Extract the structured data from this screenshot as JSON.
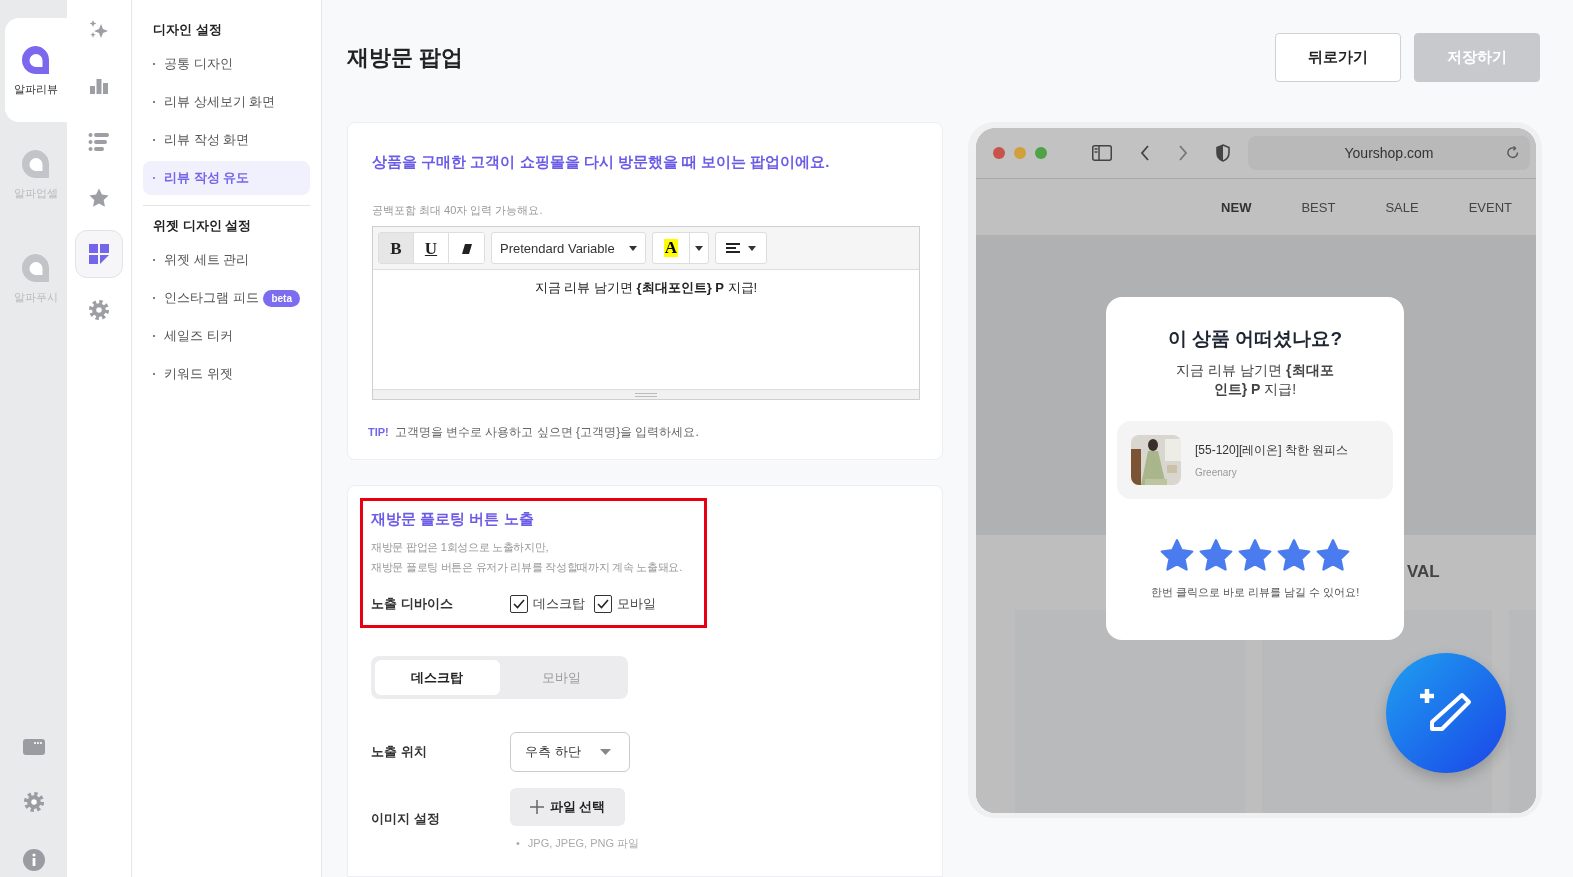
{
  "app_rail": {
    "items": [
      {
        "label": "알파리뷰",
        "selected": true
      },
      {
        "label": "알파업셀",
        "selected": false
      },
      {
        "label": "알파푸시",
        "selected": false
      }
    ],
    "footer_icons": [
      {
        "kind": "chat"
      },
      {
        "kind": "gear"
      },
      {
        "kind": "info"
      }
    ]
  },
  "icon_rail": {
    "items": [
      {
        "kind": "sparkle",
        "selected": false
      },
      {
        "kind": "chart",
        "selected": false
      },
      {
        "kind": "list",
        "selected": false
      },
      {
        "kind": "star",
        "selected": false
      },
      {
        "kind": "grid",
        "selected": true
      },
      {
        "kind": "gear",
        "selected": false
      }
    ]
  },
  "submenu": {
    "sections": [
      {
        "title": "디자인 설정",
        "items": [
          {
            "label": "공통 디자인",
            "selected": false
          },
          {
            "label": "리뷰 상세보기 화면",
            "selected": false
          },
          {
            "label": "리뷰 작성 화면",
            "selected": false
          },
          {
            "label": "리뷰 작성 유도",
            "selected": true
          }
        ]
      },
      {
        "title": "위젯 디자인 설정",
        "items": [
          {
            "label": "위젯 세트 관리",
            "selected": false
          },
          {
            "label": "인스타그램 피드",
            "badge": "beta",
            "selected": false
          },
          {
            "label": "세일즈 티커",
            "selected": false
          },
          {
            "label": "키워드 위젯",
            "selected": false
          }
        ]
      }
    ]
  },
  "header": {
    "title": "재방문 팝업",
    "buttons": [
      {
        "label": "뒤로가기",
        "disabled": false
      },
      {
        "label": "저장하기",
        "disabled": true
      }
    ]
  },
  "message_card": {
    "heading": "상품을 구매한 고객이 쇼핑몰을 다시 방문했을 때 보이는 팝업이에요.",
    "hint": "공백포함 최대 40자 입력 가능해요.",
    "editor": {
      "format_buttons": [
        {
          "kind": "bold",
          "label": "B",
          "active": true
        },
        {
          "kind": "underline",
          "label": "U",
          "active": false
        },
        {
          "kind": "eraser",
          "active": false
        }
      ],
      "font": "Pretendard Variable",
      "color_label": "A",
      "content": "지금 리뷰 남기면 **{최대포인트} P** 지급!"
    },
    "tip_label": "TIP!",
    "tip": "고객명을 변수로 사용하고 싶으면 {고객명}을 입력하세요."
  },
  "floating_card": {
    "highlighted": true,
    "title": "재방문 플로팅 버튼 노출",
    "description": [
      "재방문 팝업은 1회성으로 노출하지만,",
      "재방문 플로팅 버튼은 유저가 리뷰를 작성할때까지 계속 노출돼요."
    ],
    "device_label": "노출 디바이스",
    "devices": [
      {
        "label": "데스크탑",
        "checked": true
      },
      {
        "label": "모바일",
        "checked": true
      }
    ],
    "view_tabs": [
      {
        "label": "데스크탑",
        "selected": true
      },
      {
        "label": "모바일",
        "selected": false
      }
    ],
    "position": {
      "label": "노출 위치",
      "value": "우측 하단"
    },
    "image": {
      "label": "이미지 설정",
      "button": "파일 선택",
      "note_marker": "•",
      "notes": [
        "JPG, JPEG, PNG 파일"
      ]
    }
  },
  "preview": {
    "url": "Yourshop.com",
    "nav": [
      {
        "label": "NEW",
        "selected": true
      },
      {
        "label": "BEST",
        "selected": false
      },
      {
        "label": "SALE",
        "selected": false
      },
      {
        "label": "EVENT",
        "selected": false
      }
    ],
    "banner_text": "VAL",
    "popup": {
      "title": "이 상품 어떠셨나요?",
      "message": "지금 리뷰 남기면 **{최대포인트} P** 지급!",
      "product": {
        "name": "[55-120][레이온] 착한 원피스",
        "brand": "Greenary"
      },
      "stars": 5,
      "footer": "한번 클릭으로 바로 리뷰를 남길 수 있어요!"
    }
  }
}
